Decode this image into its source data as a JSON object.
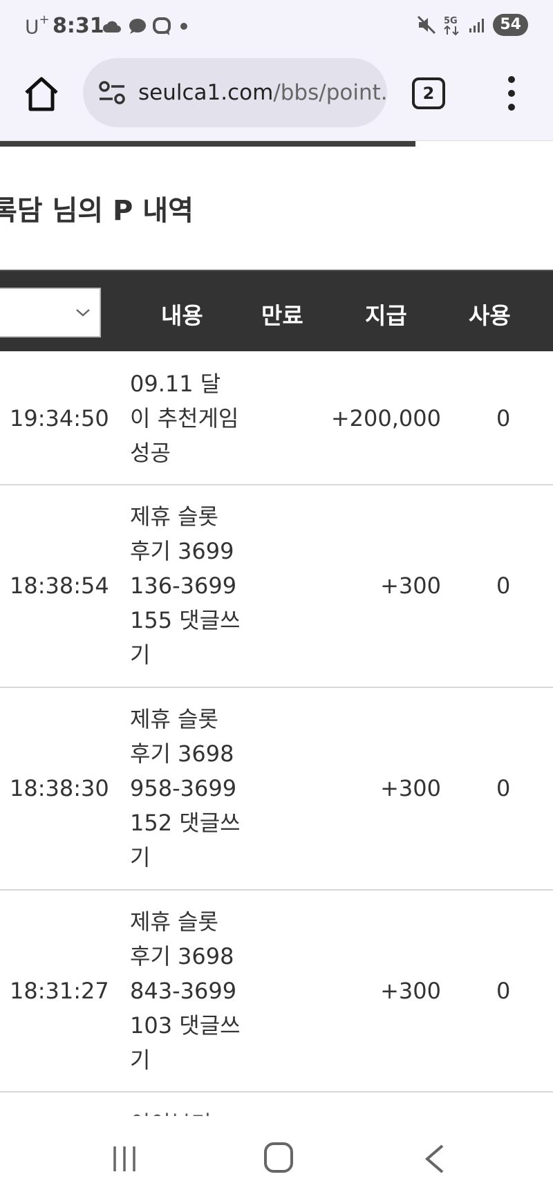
{
  "status_bar": {
    "carrier": "U",
    "carrier_sup": "+",
    "time": "8:31",
    "battery": "54"
  },
  "browser": {
    "url_domain": "seulca1.com",
    "url_path": "/bbs/point.p",
    "tab_count": "2"
  },
  "page": {
    "title": "록담 님의 P 내역"
  },
  "table": {
    "headers": {
      "content": "내용",
      "expiry": "만료",
      "given": "지급",
      "used": "사용"
    },
    "rows": [
      {
        "time": "19:34:50",
        "desc": "09.11 달이 추천게임 성공",
        "amount": "+200,000",
        "used": "0"
      },
      {
        "time": "18:38:54",
        "desc": "제휴 슬롯 후기 3699136-3699155 댓글쓰기",
        "amount": "+300",
        "used": "0"
      },
      {
        "time": "18:38:30",
        "desc": "제휴 슬롯 후기 3698958-3699152 댓글쓰기",
        "amount": "+300",
        "used": "0"
      },
      {
        "time": "18:31:27",
        "desc": "제휴 슬롯 후기 3698843-3699103 댓글쓰기",
        "amount": "+300",
        "used": "0"
      }
    ],
    "partial_row_desc": "이이분기"
  },
  "icons": {
    "home": "home-icon",
    "site_settings": "tune-icon",
    "menu": "more-vert-icon",
    "select_chevron": "chevron-down-icon",
    "nav_recent": "recent-apps-icon",
    "nav_home": "nav-home-icon",
    "nav_back": "back-icon"
  },
  "colors": {
    "header_bg": "#333333",
    "toolbar_bg": "#f4f3fb",
    "url_pill_bg": "#e3e2ec"
  }
}
